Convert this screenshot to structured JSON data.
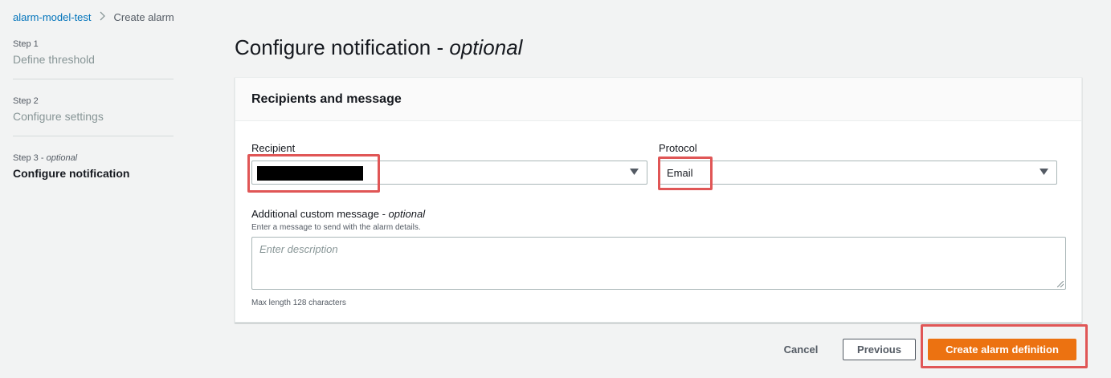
{
  "breadcrumb": {
    "parent": "alarm-model-test",
    "separator": ">",
    "current": "Create alarm"
  },
  "steps": [
    {
      "number": "Step 1",
      "name": "Define threshold"
    },
    {
      "number": "Step 2",
      "name": "Configure settings"
    },
    {
      "number": "Step 3",
      "number_suffix": "optional",
      "name": "Configure notification",
      "active": true
    }
  ],
  "page": {
    "title": "Configure notification -",
    "title_suffix": "optional"
  },
  "panel": {
    "title": "Recipients and message",
    "recipient": {
      "label": "Recipient",
      "value": ""
    },
    "protocol": {
      "label": "Protocol",
      "value": "Email"
    },
    "message": {
      "label": "Additional custom message -",
      "label_suffix": "optional",
      "description": "Enter a message to send with the alarm details.",
      "placeholder": "Enter description",
      "constraint": "Max length 128 characters"
    }
  },
  "actions": {
    "cancel": "Cancel",
    "previous": "Previous",
    "create": "Create alarm definition"
  },
  "colors": {
    "primary": "#ec7211",
    "link": "#0073bb",
    "highlight": "#e05656"
  },
  "icons": {
    "dropdown": "caret-down-icon",
    "separator": "chevron-right-icon"
  }
}
